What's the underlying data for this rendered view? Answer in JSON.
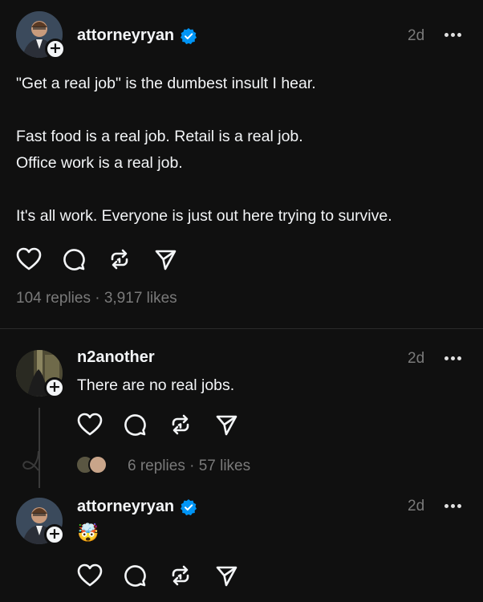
{
  "colors": {
    "background": "#101010",
    "text": "#f3f5f7",
    "muted": "#7a7a7a",
    "verified": "#0095f6"
  },
  "post": {
    "username": "attorneyryan",
    "verified": true,
    "time": "2d",
    "body": "\"Get a real job\" is the dumbest insult I hear.\n\nFast food is a real job. Retail is a real job.\nOffice work is a real job.\n\nIt's all work. Everyone is just out here trying to survive.",
    "stats": "104 replies · 3,917 likes",
    "actions": [
      "heart-icon",
      "comment-icon",
      "repost-icon",
      "share-icon"
    ]
  },
  "reply1": {
    "username": "n2another",
    "time": "2d",
    "body": "There are no real jobs.",
    "stats": "6 replies · 57 likes"
  },
  "reply2": {
    "username": "attorneyryan",
    "verified": true,
    "time": "2d",
    "body": "🤯"
  }
}
